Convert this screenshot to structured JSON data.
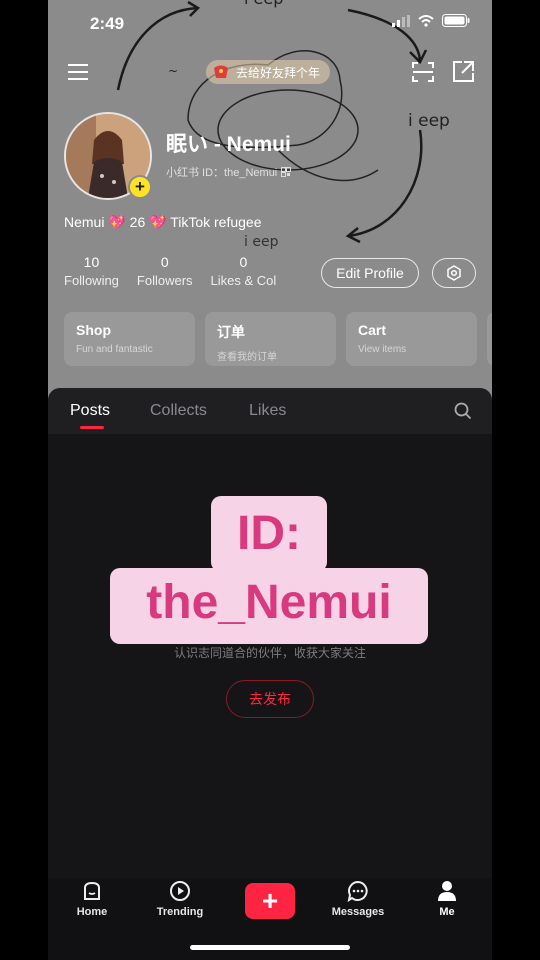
{
  "status": {
    "time": "2:49"
  },
  "topbar": {
    "promo_text": "去给好友拜个年"
  },
  "doodle": {
    "text1": "i eep",
    "text2": "i eep",
    "text3": "i eep"
  },
  "profile": {
    "name": "眠い - Nemui",
    "id_line": "小红书 ID：the_Nemui",
    "bio": "Nemui 💖 26 💖 TikTok refugee",
    "stats": [
      {
        "value": "10",
        "label": "Following"
      },
      {
        "value": "0",
        "label": "Followers"
      },
      {
        "value": "0",
        "label": "Likes & Col"
      }
    ],
    "edit_label": "Edit Profile"
  },
  "cards": [
    {
      "title": "Shop",
      "subtitle": "Fun and fantastic"
    },
    {
      "title": "订单",
      "subtitle": "查看我的订单"
    },
    {
      "title": "Cart",
      "subtitle": "View items"
    }
  ],
  "tabs": [
    "Posts",
    "Collects",
    "Likes"
  ],
  "empty": {
    "subtitle": "认识志同道合的伙伴，收获大家关注",
    "button": "去发布"
  },
  "overlay": {
    "line1": "ID:",
    "line2": "the_Nemui"
  },
  "tabbar": {
    "items": [
      "Home",
      "Trending",
      "Messages",
      "Me"
    ],
    "plus": "+"
  },
  "colors": {
    "accent": "#ff2442",
    "overlay_bg": "#f6d3e6",
    "overlay_text": "#d93a7f",
    "badge": "#ffe224"
  }
}
